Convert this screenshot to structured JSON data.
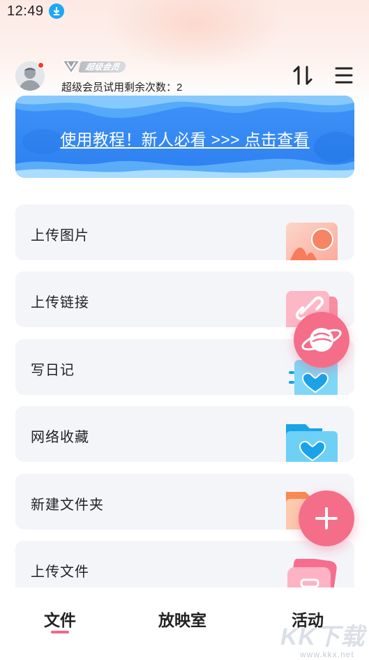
{
  "status_bar": {
    "time": "12:49",
    "download_icon": "download-badge-icon"
  },
  "header": {
    "avatar_icon": "default-avatar-icon",
    "vip_label": "超级会员",
    "trial_text": "超级会员试用剩余次数：2",
    "sort_icon": "sort-updown-icon",
    "menu_icon": "hamburger-menu-icon"
  },
  "banner": {
    "text": "使用教程！新人必看 >>> 点击查看",
    "colors": {
      "top": "#3f93f7",
      "bottom": "#2c7ff0"
    }
  },
  "actions": [
    {
      "label": "上传图片",
      "icon": "image-upload-icon"
    },
    {
      "label": "上传链接",
      "icon": "link-upload-icon"
    },
    {
      "label": "写日记",
      "icon": "diary-icon"
    },
    {
      "label": "网络收藏",
      "icon": "favorite-folder-icon"
    },
    {
      "label": "新建文件夹",
      "icon": "new-folder-icon"
    },
    {
      "label": "上传文件",
      "icon": "file-upload-icon"
    }
  ],
  "floating": {
    "planet_icon": "planet-icon",
    "add_icon": "plus-icon",
    "accent": "#f46e8a"
  },
  "tabs": [
    {
      "label": "文件",
      "active": true
    },
    {
      "label": "放映室",
      "active": false
    },
    {
      "label": "活动",
      "active": false
    }
  ],
  "watermark": {
    "main": "KK下载",
    "url": "www.kkx.net"
  }
}
